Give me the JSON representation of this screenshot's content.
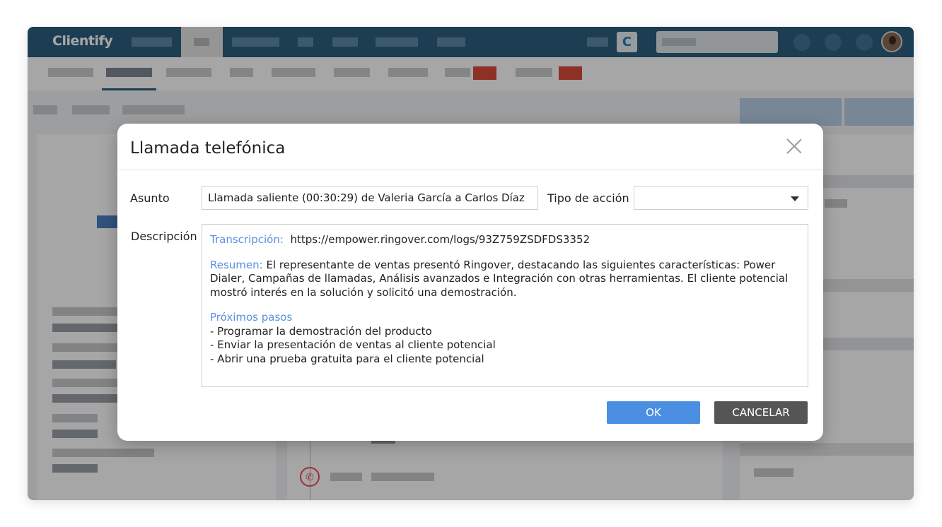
{
  "topbar": {
    "logo": "Clientify",
    "c_badge": "C",
    "avatar_icon": "user-avatar-icon"
  },
  "modal": {
    "title": "Llamada telefónica",
    "close_icon": "close-icon",
    "fields": {
      "asunto_label": "Asunto",
      "asunto_value": "Llamada saliente (00:30:29) de Valeria García a Carlos Díaz",
      "tipo_label": "Tipo de acción",
      "tipo_value": "",
      "descripcion_label": "Descripción"
    },
    "description": {
      "transcripcion_label": "Transcripción:",
      "transcripcion_url": "https://empower.ringover.com/logs/93Z759ZSDFDS3352",
      "resumen_label": "Resumen:",
      "resumen_text": "El representante de ventas presentó Ringover, destacando las siguientes características: Power Dialer, Campañas de llamadas, Análisis avanzados e Integración con otras herramientas. El cliente potencial mostró interés en la solución y solicitó una demostración.",
      "proximos_label": "Próximos pasos",
      "steps": [
        "- Programar la demostración del producto",
        "- Enviar la presentación de ventas al cliente potencial",
        "- Abrir una prueba gratuita para el cliente potencial"
      ]
    },
    "buttons": {
      "ok": "OK",
      "cancel": "CANCELAR"
    }
  },
  "colors": {
    "topbar": "#2b5f7f",
    "accent_blue": "#4a8fe2",
    "highlight_text": "#5a8fe0",
    "cancel_button": "#555555",
    "badge_red": "#d94a3a"
  }
}
